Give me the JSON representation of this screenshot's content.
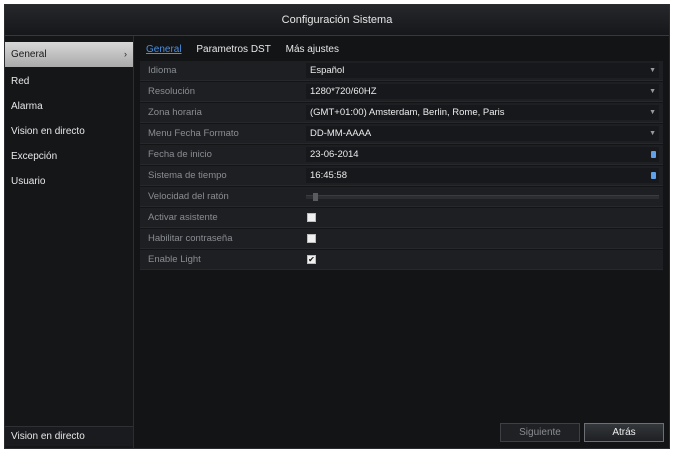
{
  "window": {
    "title": "Configuración Sistema"
  },
  "sidebar": {
    "items": [
      {
        "label": "General",
        "active": true
      },
      {
        "label": "Red"
      },
      {
        "label": "Alarma"
      },
      {
        "label": "Vision en directo"
      },
      {
        "label": "Excepción"
      },
      {
        "label": "Usuario"
      }
    ],
    "footer": "Vision en directo"
  },
  "tabs": [
    {
      "label": "General",
      "active": true
    },
    {
      "label": "Parametros DST"
    },
    {
      "label": "Más ajustes"
    }
  ],
  "fields": {
    "idioma": {
      "label": "Idioma",
      "value": "Español"
    },
    "resolucion": {
      "label": "Resolución",
      "value": "1280*720/60HZ"
    },
    "zona": {
      "label": "Zona horaria",
      "value": "(GMT+01:00) Amsterdam, Berlin, Rome, Paris"
    },
    "fecha_formato": {
      "label": "Menu Fecha Formato",
      "value": "DD-MM-AAAA"
    },
    "fecha_inicio": {
      "label": "Fecha de inicio",
      "value": "23-06-2014"
    },
    "sistema_tiempo": {
      "label": "Sistema de tiempo",
      "value": "16:45:58"
    },
    "velocidad": {
      "label": "Velocidad del ratón",
      "level": 0.02
    },
    "activar_asistente": {
      "label": "Activar asistente",
      "checked": false
    },
    "habilitar_contrasena": {
      "label": "Habilitar contraseña",
      "checked": false
    },
    "enable_light": {
      "label": "Enable Light",
      "checked": true
    }
  },
  "buttons": {
    "next": "Siguiente",
    "back": "Atrás"
  },
  "icons": {
    "dropdown": "chevron-down-icon",
    "spinner": "spinner-icon",
    "sidebar_active": "chevron-right-icon",
    "check": "checkmark-icon"
  },
  "glyphs": {
    "chevron_right": "›",
    "dropdown": "▼",
    "check": "✔"
  },
  "colors": {
    "accent": "#4a8fe0",
    "background": "#111214"
  }
}
